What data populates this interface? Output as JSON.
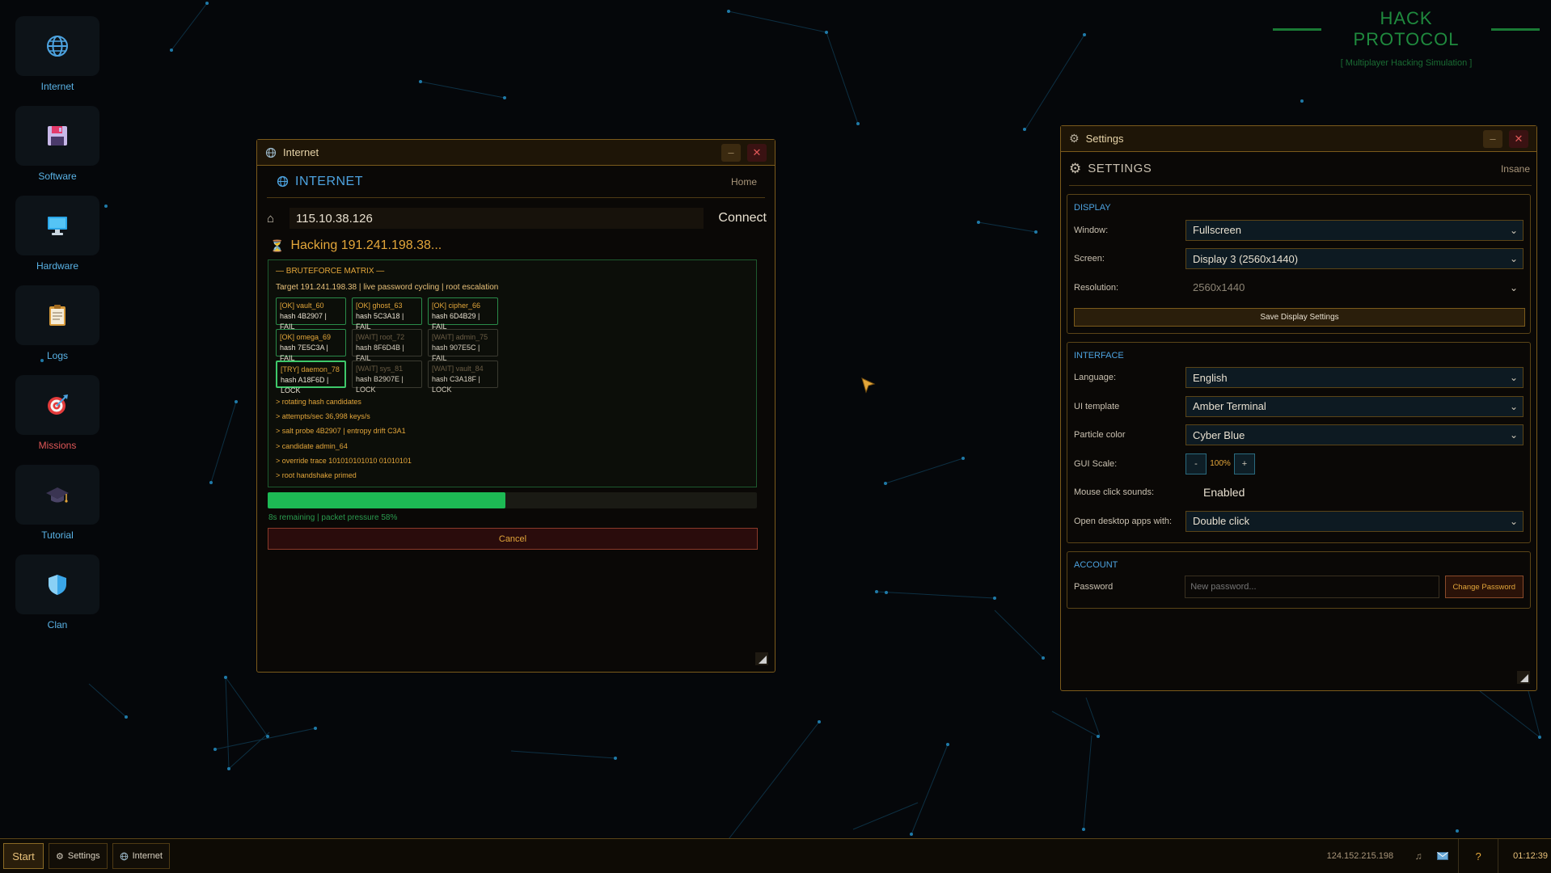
{
  "brand": {
    "title": "HACK PROTOCOL",
    "subtitle": "[ Multiplayer Hacking Simulation ]"
  },
  "desktop_icons": [
    {
      "label": "Internet",
      "icon": "globe-icon"
    },
    {
      "label": "Software",
      "icon": "floppy-disk-icon"
    },
    {
      "label": "Hardware",
      "icon": "monitor-icon"
    },
    {
      "label": "Logs",
      "icon": "clipboard-icon"
    },
    {
      "label": "Missions",
      "icon": "target-icon"
    },
    {
      "label": "Tutorial",
      "icon": "graduation-cap-icon"
    },
    {
      "label": "Clan",
      "icon": "shield-icon"
    }
  ],
  "internet_window": {
    "title": "Internet",
    "header": "INTERNET",
    "home_link": "Home",
    "address": "115.10.38.126",
    "connect_label": "Connect",
    "hacking_status": "Hacking 191.241.198.38...",
    "matrix": {
      "title": "— BRUTEFORCE MATRIX —",
      "target": "Target 191.241.198.38 | live password cycling | root escalation",
      "cells": [
        {
          "name": "[OK] vault_60",
          "hash": "hash 4B2907 | FAIL",
          "state": "ok"
        },
        {
          "name": "[OK] ghost_63",
          "hash": "hash 5C3A18 | FAIL",
          "state": "ok"
        },
        {
          "name": "[OK] cipher_66",
          "hash": "hash 6D4B29 | FAIL",
          "state": "ok"
        },
        {
          "name": "[OK] omega_69",
          "hash": "hash 7E5C3A | FAIL",
          "state": "ok"
        },
        {
          "name": "[WAIT] root_72",
          "hash": "hash 8F6D4B | FAIL",
          "state": "wait"
        },
        {
          "name": "[WAIT] admin_75",
          "hash": "hash 907E5C | FAIL",
          "state": "wait"
        },
        {
          "name": "[TRY] daemon_78",
          "hash": "hash A18F6D | LOCK",
          "state": "try"
        },
        {
          "name": "[WAIT] sys_81",
          "hash": "hash B2907E | LOCK",
          "state": "wait"
        },
        {
          "name": "[WAIT] vault_84",
          "hash": "hash C3A18F | LOCK",
          "state": "wait"
        }
      ],
      "log": [
        "> rotating hash candidates",
        "> attempts/sec 36,998 keys/s",
        "> salt probe 4B2907 | entropy drift C3A1",
        "> candidate admin_64",
        "> override trace 101010101010  01010101",
        "> root handshake primed"
      ]
    },
    "progress": 0.486,
    "progress_text": "8s remaining | packet pressure 58%",
    "cancel_label": "Cancel"
  },
  "settings_window": {
    "title": "Settings",
    "header": "SETTINGS",
    "difficulty": "Insane",
    "display": {
      "title": "DISPLAY",
      "window_label": "Window:",
      "window_value": "Fullscreen",
      "screen_label": "Screen:",
      "screen_value": "Display 3 (2560x1440)",
      "resolution_label": "Resolution:",
      "resolution_value": "2560x1440",
      "save_label": "Save Display Settings"
    },
    "interface": {
      "title": "INTERFACE",
      "language_label": "Language:",
      "language_value": "English",
      "template_label": "UI template",
      "template_value": "Amber Terminal",
      "particle_label": "Particle color",
      "particle_value": "Cyber Blue",
      "scale_label": "GUI Scale:",
      "scale_minus": "-",
      "scale_value": "100%",
      "scale_plus": "+",
      "sounds_label": "Mouse click sounds:",
      "sounds_value": "Enabled",
      "open_label": "Open desktop apps with:",
      "open_value": "Double click"
    },
    "account": {
      "title": "ACCOUNT",
      "password_label": "Password",
      "password_placeholder": "New password...",
      "change_label": "Change Password"
    }
  },
  "taskbar": {
    "start_label": "Start",
    "tasks": [
      {
        "label": "Settings",
        "icon": "gear-icon"
      },
      {
        "label": "Internet",
        "icon": "globe-icon"
      }
    ],
    "ip": "124.152.215.198",
    "help_label": "?",
    "clock": "01:12:39"
  },
  "colors": {
    "accent_amber": "#e3a63a",
    "accent_blue": "#4da3e0",
    "success_green": "#1db954",
    "danger_red": "#e05757",
    "border": "#7b5a1b"
  }
}
